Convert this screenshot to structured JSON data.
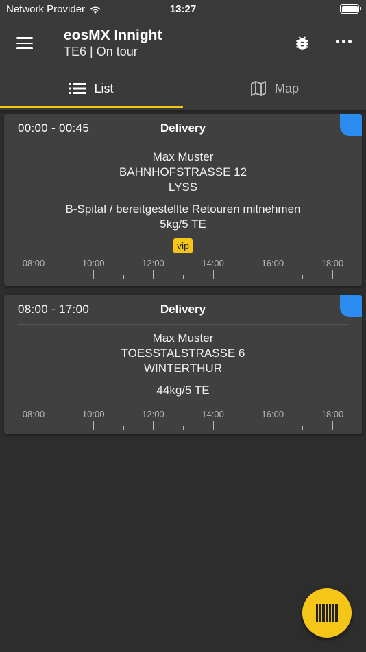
{
  "status_bar": {
    "carrier": "Network Provider",
    "time": "13:27"
  },
  "header": {
    "title": "eosMX Innight",
    "subtitle": "TE6 | On tour"
  },
  "tabs": [
    {
      "label": "List",
      "icon": "list-icon",
      "active": true
    },
    {
      "label": "Map",
      "icon": "map-icon",
      "active": false
    }
  ],
  "timeline_labels": [
    "08:00",
    "10:00",
    "12:00",
    "14:00",
    "16:00",
    "18:00"
  ],
  "cards": [
    {
      "time": "00:00 - 00:45",
      "type": "Delivery",
      "name": "Max Muster",
      "street": "BAHNHOFSTRASSE 12",
      "city": "LYSS",
      "note": "B-Spital / bereitgestellte Retouren mitnehmen",
      "weight": "5kg/5 TE",
      "badge": "vip"
    },
    {
      "time": "08:00 - 17:00",
      "type": "Delivery",
      "name": "Max Muster",
      "street": "TOESSTALSTRASSE 6",
      "city": "WINTERTHUR",
      "weight": "44kg/5 TE"
    }
  ],
  "colors": {
    "accent": "#f5c518",
    "card_corner": "#2d8cf0",
    "background": "#2d2d2d"
  }
}
